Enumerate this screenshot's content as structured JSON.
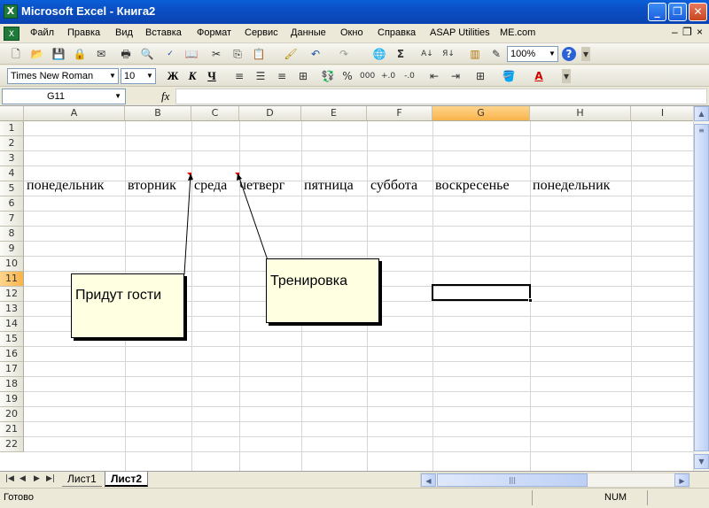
{
  "window": {
    "title": "Microsoft Excel - Книга2",
    "app_icon_letter": "X"
  },
  "menu": {
    "items": [
      "Файл",
      "Правка",
      "Вид",
      "Вставка",
      "Формат",
      "Сервис",
      "Данные",
      "Окно",
      "Справка",
      "ASAP Utilities",
      "ME.com"
    ]
  },
  "toolbar": {
    "zoom": "100%"
  },
  "format_toolbar": {
    "font": "Times New Roman",
    "size": "10",
    "bold": "Ж",
    "italic": "К",
    "underline": "Ч",
    "percent": "%",
    "thousands": "000"
  },
  "formula_bar": {
    "cell_ref": "G11",
    "fx": "fx"
  },
  "grid": {
    "columns": [
      "A",
      "B",
      "C",
      "D",
      "E",
      "F",
      "G",
      "H",
      "I"
    ],
    "selected_column": "G",
    "selected_row": "11",
    "rows": [
      "1",
      "2",
      "3",
      "4",
      "5",
      "6",
      "7",
      "8",
      "9",
      "10",
      "11",
      "12",
      "13",
      "14",
      "15",
      "16",
      "17",
      "18",
      "19",
      "20",
      "21",
      "22"
    ],
    "row4": [
      "понедельник",
      "вторник",
      "среда",
      "четверг",
      "пятница",
      "суббота",
      "воскресенье",
      "понедельник"
    ]
  },
  "comments": [
    {
      "text": "Придут гости",
      "anchor_cell": "B4"
    },
    {
      "text": "Тренировка",
      "anchor_cell": "C4"
    }
  ],
  "sheets": {
    "tabs": [
      "Лист1",
      "Лист2"
    ],
    "active": "Лист2"
  },
  "status": {
    "ready": "Готово",
    "num": "NUM"
  }
}
